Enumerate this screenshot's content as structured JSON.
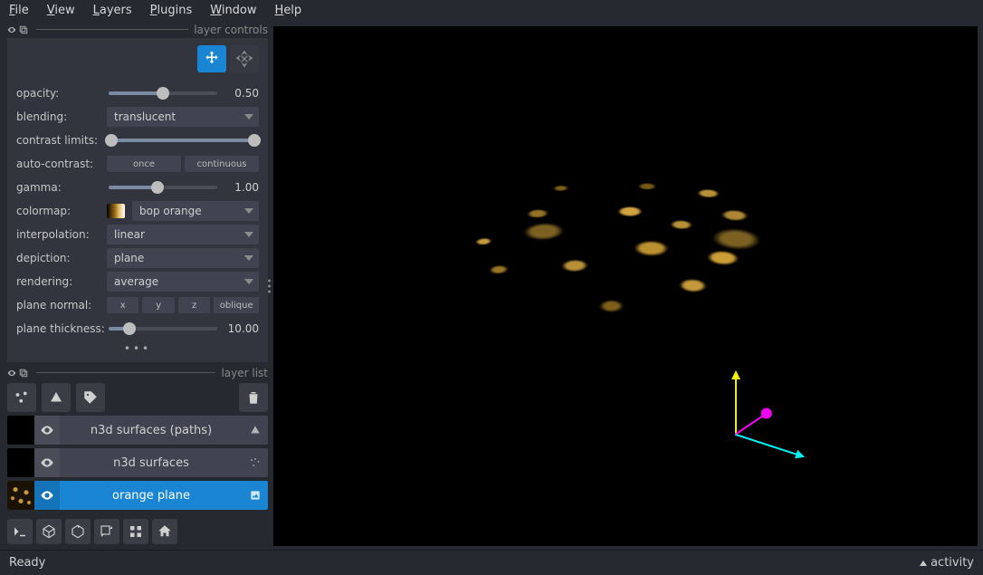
{
  "menu": {
    "file": "File",
    "view": "View",
    "layers": "Layers",
    "plugins": "Plugins",
    "window": "Window",
    "help": "Help"
  },
  "panels": {
    "controls_title": "layer controls",
    "list_title": "layer list"
  },
  "controls": {
    "opacity_label": "opacity:",
    "opacity_value": "0.50",
    "blending_label": "blending:",
    "blending_value": "translucent",
    "contrast_label": "contrast limits:",
    "autocontrast_label": "auto-contrast:",
    "autocontrast_once": "once",
    "autocontrast_continuous": "continuous",
    "gamma_label": "gamma:",
    "gamma_value": "1.00",
    "colormap_label": "colormap:",
    "colormap_value": "bop orange",
    "interpolation_label": "interpolation:",
    "interpolation_value": "linear",
    "depiction_label": "depiction:",
    "depiction_value": "plane",
    "rendering_label": "rendering:",
    "rendering_value": "average",
    "plane_normal_label": "plane normal:",
    "axis_x": "x",
    "axis_y": "y",
    "axis_z": "z",
    "axis_oblique": "oblique",
    "plane_thickness_label": "plane thickness:",
    "plane_thickness_value": "10.00"
  },
  "layers": [
    {
      "name": "n3d surfaces (paths)",
      "thumb": "black",
      "selected": false
    },
    {
      "name": "n3d surfaces",
      "thumb": "black",
      "selected": false
    },
    {
      "name": "orange plane",
      "thumb": "orange",
      "selected": true
    }
  ],
  "status": {
    "left": "Ready",
    "right": "activity"
  }
}
